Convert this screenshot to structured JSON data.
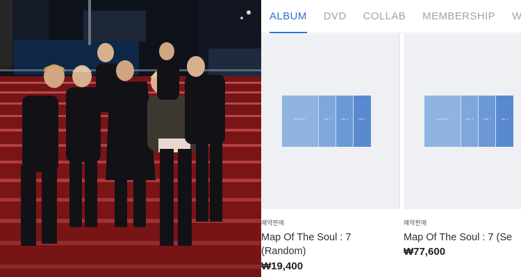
{
  "tabs": [
    {
      "label": "ALBUM",
      "active": true
    },
    {
      "label": "DVD",
      "active": false
    },
    {
      "label": "COLLAB",
      "active": false
    },
    {
      "label": "MEMBERSHIP",
      "active": false
    },
    {
      "label": "WEV",
      "active": false
    }
  ],
  "colors": {
    "accent": "#2a6fd6",
    "tab_inactive": "#9aa3b0",
    "album_blue": "#6b9ad6"
  },
  "products": [
    {
      "badge": "예약판매",
      "name_line1": "Map Of The Soul : 7",
      "name_line2": "(Random)",
      "price": "₩19,400",
      "cover_labels": [
        "VERSION 1",
        "VER. 2",
        "VER. 3",
        "VER. 4"
      ]
    },
    {
      "badge": "예약판매",
      "name_line1": "Map Of The Soul : 7 (Se",
      "price": "₩77,600",
      "cover_labels": [
        "VERSION 1",
        "VER. 2",
        "VER. 3",
        "VER. 4"
      ]
    }
  ]
}
